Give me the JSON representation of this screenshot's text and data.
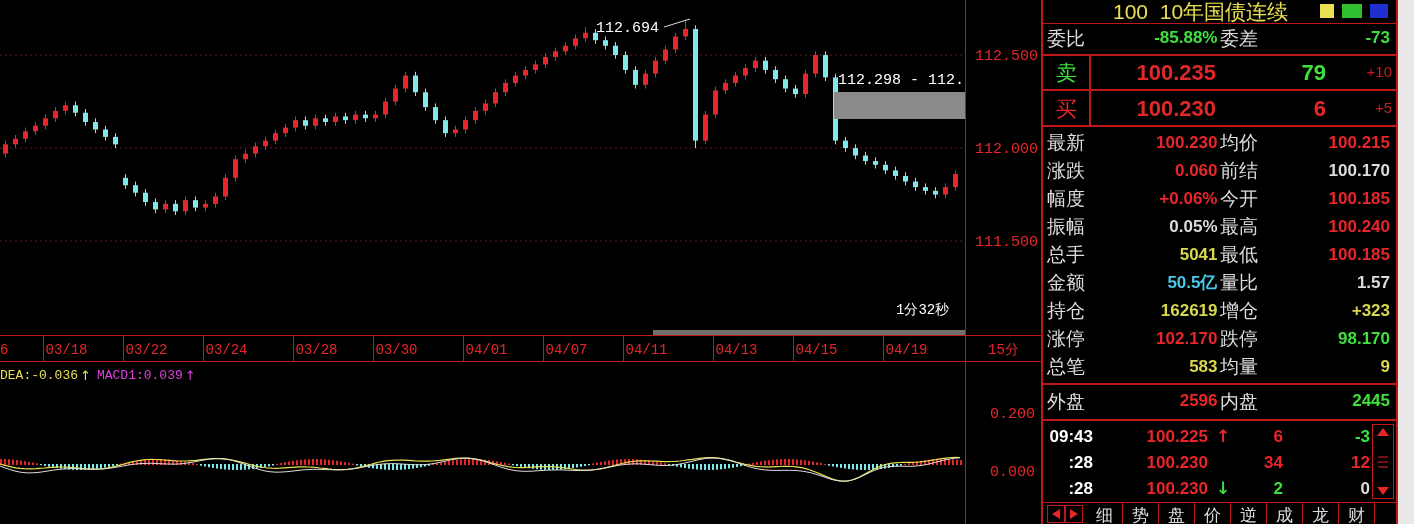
{
  "chart": {
    "chart_data": {
      "type": "candlestick",
      "categories": [
        null,
        null,
        null,
        null,
        null,
        null,
        "03/18",
        null,
        null,
        null,
        null,
        null,
        null,
        null,
        "03/22",
        null,
        null,
        null,
        null,
        null,
        null,
        null,
        "03/24",
        null,
        null,
        null,
        null,
        null,
        null,
        null,
        null,
        "03/28",
        null,
        null,
        null,
        null,
        null,
        null,
        null,
        "03/30",
        null,
        null,
        null,
        null,
        null,
        null,
        null,
        null,
        "04/01",
        null,
        null,
        null,
        null,
        null,
        null,
        null,
        "04/07",
        null,
        null,
        null,
        null,
        null,
        null,
        null,
        "04/11",
        null,
        null,
        null,
        null,
        null,
        null,
        null,
        null,
        "04/13",
        null,
        null,
        null,
        null,
        null,
        null,
        null,
        "04/15",
        null,
        null,
        null,
        null,
        null,
        null,
        null,
        null,
        "04/19",
        null,
        null,
        null,
        null,
        null
      ],
      "grid": true,
      "ohlc": [
        [
          111.97,
          112.04,
          111.95,
          112.02
        ],
        [
          112.02,
          112.07,
          112.0,
          112.05
        ],
        [
          112.05,
          112.11,
          112.03,
          112.09
        ],
        [
          112.09,
          112.14,
          112.07,
          112.12
        ],
        [
          112.12,
          112.18,
          112.1,
          112.16
        ],
        [
          112.16,
          112.22,
          112.14,
          112.2
        ],
        [
          112.2,
          112.25,
          112.18,
          112.23
        ],
        [
          112.23,
          112.25,
          112.17,
          112.19
        ],
        [
          112.19,
          112.21,
          112.12,
          112.14
        ],
        [
          112.14,
          112.16,
          112.08,
          112.1
        ],
        [
          112.1,
          112.12,
          112.04,
          112.06
        ],
        [
          112.06,
          112.08,
          112.0,
          112.02
        ],
        [
          111.84,
          111.86,
          111.78,
          111.8
        ],
        [
          111.8,
          111.82,
          111.74,
          111.76
        ],
        [
          111.76,
          111.78,
          111.69,
          111.71
        ],
        [
          111.71,
          111.73,
          111.65,
          111.67
        ],
        [
          111.67,
          111.72,
          111.65,
          111.7
        ],
        [
          111.7,
          111.72,
          111.64,
          111.66
        ],
        [
          111.66,
          111.74,
          111.64,
          111.72
        ],
        [
          111.72,
          111.74,
          111.66,
          111.68
        ],
        [
          111.68,
          111.72,
          111.66,
          111.7
        ],
        [
          111.7,
          111.76,
          111.68,
          111.74
        ],
        [
          111.74,
          111.86,
          111.72,
          111.84
        ],
        [
          111.84,
          111.96,
          111.82,
          111.94
        ],
        [
          111.94,
          111.99,
          111.92,
          111.97
        ],
        [
          111.97,
          112.03,
          111.95,
          112.01
        ],
        [
          112.01,
          112.06,
          111.99,
          112.04
        ],
        [
          112.04,
          112.1,
          112.02,
          112.08
        ],
        [
          112.08,
          112.13,
          112.06,
          112.11
        ],
        [
          112.11,
          112.17,
          112.09,
          112.15
        ],
        [
          112.15,
          112.17,
          112.1,
          112.12
        ],
        [
          112.12,
          112.18,
          112.1,
          112.16
        ],
        [
          112.16,
          112.18,
          112.12,
          112.14
        ],
        [
          112.14,
          112.19,
          112.12,
          112.17
        ],
        [
          112.17,
          112.19,
          112.13,
          112.15
        ],
        [
          112.15,
          112.2,
          112.13,
          112.18
        ],
        [
          112.18,
          112.2,
          112.14,
          112.16
        ],
        [
          112.16,
          112.2,
          112.14,
          112.18
        ],
        [
          112.18,
          112.27,
          112.16,
          112.25
        ],
        [
          112.25,
          112.34,
          112.23,
          112.32
        ],
        [
          112.32,
          112.41,
          112.3,
          112.39
        ],
        [
          112.39,
          112.41,
          112.28,
          112.3
        ],
        [
          112.3,
          112.32,
          112.2,
          112.22
        ],
        [
          112.22,
          112.24,
          112.13,
          112.15
        ],
        [
          112.15,
          112.17,
          112.06,
          112.08
        ],
        [
          112.08,
          112.12,
          112.06,
          112.1
        ],
        [
          112.1,
          112.17,
          112.08,
          112.15
        ],
        [
          112.15,
          112.22,
          112.13,
          112.2
        ],
        [
          112.2,
          112.26,
          112.18,
          112.24
        ],
        [
          112.24,
          112.32,
          112.22,
          112.3
        ],
        [
          112.3,
          112.37,
          112.28,
          112.35
        ],
        [
          112.35,
          112.41,
          112.33,
          112.39
        ],
        [
          112.39,
          112.44,
          112.37,
          112.42
        ],
        [
          112.42,
          112.47,
          112.4,
          112.45
        ],
        [
          112.45,
          112.51,
          112.43,
          112.49
        ],
        [
          112.49,
          112.54,
          112.47,
          112.52
        ],
        [
          112.52,
          112.57,
          112.5,
          112.55
        ],
        [
          112.55,
          112.61,
          112.53,
          112.59
        ],
        [
          112.59,
          112.65,
          112.57,
          112.62
        ],
        [
          112.62,
          112.64,
          112.56,
          112.58
        ],
        [
          112.58,
          112.6,
          112.53,
          112.55
        ],
        [
          112.55,
          112.57,
          112.48,
          112.5
        ],
        [
          112.5,
          112.52,
          112.4,
          112.42
        ],
        [
          112.42,
          112.44,
          112.32,
          112.34
        ],
        [
          112.34,
          112.42,
          112.32,
          112.4
        ],
        [
          112.4,
          112.49,
          112.38,
          112.47
        ],
        [
          112.47,
          112.55,
          112.45,
          112.53
        ],
        [
          112.53,
          112.62,
          112.51,
          112.6
        ],
        [
          112.6,
          112.69,
          112.58,
          112.64
        ],
        [
          112.64,
          112.66,
          112.0,
          112.04
        ],
        [
          112.04,
          112.2,
          112.02,
          112.18
        ],
        [
          112.18,
          112.33,
          112.16,
          112.31
        ],
        [
          112.31,
          112.37,
          112.29,
          112.35
        ],
        [
          112.35,
          112.41,
          112.33,
          112.39
        ],
        [
          112.39,
          112.45,
          112.37,
          112.43
        ],
        [
          112.43,
          112.49,
          112.41,
          112.47
        ],
        [
          112.47,
          112.49,
          112.4,
          112.42
        ],
        [
          112.42,
          112.44,
          112.35,
          112.37
        ],
        [
          112.37,
          112.39,
          112.3,
          112.32
        ],
        [
          112.32,
          112.34,
          112.27,
          112.29
        ],
        [
          112.29,
          112.42,
          112.27,
          112.4
        ],
        [
          112.4,
          112.52,
          112.38,
          112.5
        ],
        [
          112.5,
          112.52,
          112.36,
          112.38
        ],
        [
          112.38,
          112.4,
          112.02,
          112.04
        ],
        [
          112.04,
          112.06,
          111.98,
          112.0
        ],
        [
          112.0,
          112.02,
          111.94,
          111.96
        ],
        [
          111.96,
          111.98,
          111.91,
          111.93
        ],
        [
          111.93,
          111.95,
          111.89,
          111.91
        ],
        [
          111.91,
          111.93,
          111.86,
          111.88
        ],
        [
          111.88,
          111.9,
          111.83,
          111.85
        ],
        [
          111.85,
          111.87,
          111.8,
          111.82
        ],
        [
          111.82,
          111.84,
          111.77,
          111.79
        ],
        [
          111.79,
          111.81,
          111.75,
          111.77
        ],
        [
          111.77,
          111.79,
          111.73,
          111.75
        ],
        [
          111.75,
          111.81,
          111.73,
          111.79
        ],
        [
          111.79,
          111.88,
          111.77,
          111.86
        ]
      ],
      "yticks": [
        {
          "value": 112.5,
          "label": "112.500"
        },
        {
          "value": 112.0,
          "label": "112.000"
        },
        {
          "value": 111.5,
          "label": "111.500"
        }
      ],
      "ylim": [
        110.995,
        112.796
      ]
    },
    "high_label": "112.694",
    "range_label": "112.298 - 112.",
    "countdown": "1分32秒",
    "x_edge_label": "6",
    "period": "15分"
  },
  "indicator": {
    "readouts": [
      {
        "text": "DEA:-0.036",
        "arrow": "↑",
        "color": "#e8e050"
      },
      {
        "text": "MACD1:0.039",
        "arrow": "↑",
        "color": "#e040e0"
      }
    ],
    "y_labels": [
      "0.200",
      "0.000"
    ]
  },
  "quote": {
    "title": "100  10年国债连续",
    "ratio": [
      {
        "label": "委比",
        "value": "-85.88%",
        "color": "#3ee03e"
      },
      {
        "label": "委差",
        "value": "-73",
        "color": "#3ee03e"
      }
    ],
    "book": [
      {
        "side": {
          "text": "卖",
          "color": "#3ee03e"
        },
        "price": "100.235",
        "volume": {
          "text": "79",
          "color": "#3ee03e"
        },
        "change": "+10"
      },
      {
        "side": {
          "text": "买",
          "color": "#e8262a"
        },
        "price": "100.230",
        "volume": {
          "text": "6",
          "color": "#e8262a"
        },
        "change": "+5"
      }
    ],
    "stats": [
      {
        "label": "最新",
        "value": "100.230",
        "color": "#e8262a"
      },
      {
        "label": "均价",
        "value": "100.215",
        "color": "#e8262a"
      },
      {
        "label": "涨跌",
        "value": "0.060",
        "color": "#e8262a"
      },
      {
        "label": "前结",
        "value": "100.170",
        "color": "#dcdcdc"
      },
      {
        "label": "幅度",
        "value": "+0.06%",
        "color": "#e8262a"
      },
      {
        "label": "今开",
        "value": "100.185",
        "color": "#e8262a"
      },
      {
        "label": "振幅",
        "value": "0.05%",
        "color": "#dcdcdc"
      },
      {
        "label": "最高",
        "value": "100.240",
        "color": "#e8262a"
      },
      {
        "label": "总手",
        "value": "5041",
        "color": "#d8d84a"
      },
      {
        "label": "最低",
        "value": "100.185",
        "color": "#e8262a"
      },
      {
        "label": "金额",
        "value": "50.5亿",
        "color": "#4ac8e8"
      },
      {
        "label": "量比",
        "value": "1.57",
        "color": "#dcdcdc"
      },
      {
        "label": "持仓",
        "value": "162619",
        "color": "#d8d84a"
      },
      {
        "label": "增仓",
        "value": "+323",
        "color": "#d8d84a"
      },
      {
        "label": "涨停",
        "value": "102.170",
        "color": "#e8262a"
      },
      {
        "label": "跌停",
        "value": "98.170",
        "color": "#3ee03e"
      },
      {
        "label": "总笔",
        "value": "583",
        "color": "#d8d84a"
      },
      {
        "label": "均量",
        "value": "9",
        "color": "#d8d84a"
      }
    ],
    "sides": [
      {
        "label": "外盘",
        "value": "2596",
        "color": "#e8262a"
      },
      {
        "label": "内盘",
        "value": "2445",
        "color": "#3ee03e"
      }
    ],
    "ticks": [
      {
        "time": "09:43",
        "price": "100.225",
        "arrow": {
          "text": "↑",
          "color": "#e8262a"
        },
        "volume": {
          "text": "6",
          "color": "#e8262a"
        },
        "change": {
          "text": "-3",
          "color": "#3ee03e"
        }
      },
      {
        "time": ":28",
        "price": "100.230",
        "volume": {
          "text": "34",
          "color": "#e8262a"
        },
        "change": {
          "text": "12",
          "color": "#e8262a"
        }
      },
      {
        "time": ":28",
        "price": "100.230",
        "arrow": {
          "text": "↓",
          "color": "#3ee03e"
        },
        "volume": {
          "text": "2",
          "color": "#3ee03e"
        },
        "change": {
          "text": "0",
          "color": "#dcdcdc"
        }
      }
    ],
    "tabs": [
      "细",
      "势",
      "盘",
      "价",
      "逆",
      "成",
      "龙",
      "财"
    ]
  }
}
